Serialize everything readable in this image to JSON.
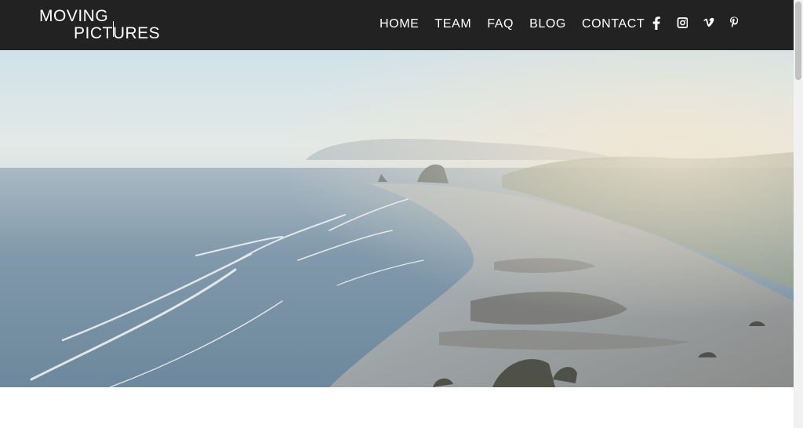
{
  "logo": {
    "line1": "MOVING",
    "line2": "PICTURES"
  },
  "nav": {
    "items": [
      {
        "label": "HOME"
      },
      {
        "label": "TEAM"
      },
      {
        "label": "FAQ"
      },
      {
        "label": "BLOG"
      },
      {
        "label": "CONTACT"
      }
    ]
  },
  "social": [
    "facebook-icon",
    "instagram-icon",
    "vimeo-icon",
    "pinterest-icon"
  ],
  "colors": {
    "navbar": "#222222",
    "text": "#ffffff"
  }
}
